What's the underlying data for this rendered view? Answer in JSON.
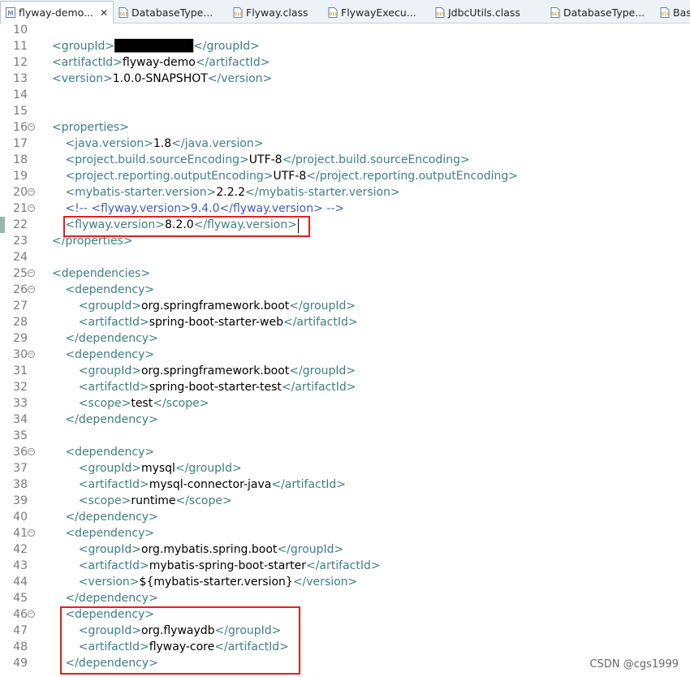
{
  "tabs": [
    {
      "label": "flyway-demo...",
      "icon": "maven-pom-icon",
      "active": true
    },
    {
      "label": "DatabaseType...",
      "icon": "class-file-icon"
    },
    {
      "label": "Flyway.class",
      "icon": "class-file-icon"
    },
    {
      "label": "FlywayExecu...",
      "icon": "class-file-icon"
    },
    {
      "label": "JdbcUtils.class",
      "icon": "class-file-icon"
    },
    {
      "label": "DatabaseType...",
      "icon": "class-file-icon"
    },
    {
      "label": "Base",
      "icon": "class-file-icon"
    }
  ],
  "colors": {
    "tag": "#3f7f7f",
    "text": "#000000",
    "comment": "#3f5fbf",
    "highlight_box": "#e02020"
  },
  "lines": [
    {
      "n": "10",
      "text": ""
    },
    {
      "n": "11",
      "text": "<groupId>█████████</groupId>"
    },
    {
      "n": "12",
      "text": "<artifactId>flyway-demo</artifactId>"
    },
    {
      "n": "13",
      "text": "<version>1.0.0-SNAPSHOT</version>"
    },
    {
      "n": "14",
      "text": ""
    },
    {
      "n": "15",
      "text": ""
    },
    {
      "n": "16",
      "text": "<properties>",
      "fold": true
    },
    {
      "n": "17",
      "text": "  <java.version>1.8</java.version>"
    },
    {
      "n": "18",
      "text": "  <project.build.sourceEncoding>UTF-8</project.build.sourceEncoding>"
    },
    {
      "n": "19",
      "text": "  <project.reporting.outputEncoding>UTF-8</project.reporting.outputEncoding>"
    },
    {
      "n": "20",
      "text": "  <mybatis-starter.version>2.2.2</mybatis-starter.version>",
      "fold": true
    },
    {
      "n": "21",
      "text": "  <!-- <flyway.version>9.4.0</flyway.version> -->",
      "fold": true,
      "comment": true
    },
    {
      "n": "22",
      "text": "  <flyway.version>8.2.0</flyway.version>",
      "marked": true
    },
    {
      "n": "23",
      "text": "</properties>"
    },
    {
      "n": "24",
      "text": ""
    },
    {
      "n": "25",
      "text": "<dependencies>",
      "fold": true
    },
    {
      "n": "26",
      "text": "  <dependency>",
      "fold": true
    },
    {
      "n": "27",
      "text": "    <groupId>org.springframework.boot</groupId>"
    },
    {
      "n": "28",
      "text": "    <artifactId>spring-boot-starter-web</artifactId>"
    },
    {
      "n": "29",
      "text": "  </dependency>"
    },
    {
      "n": "30",
      "text": "  <dependency>",
      "fold": true
    },
    {
      "n": "31",
      "text": "    <groupId>org.springframework.boot</groupId>"
    },
    {
      "n": "32",
      "text": "    <artifactId>spring-boot-starter-test</artifactId>"
    },
    {
      "n": "33",
      "text": "    <scope>test</scope>"
    },
    {
      "n": "34",
      "text": "  </dependency>"
    },
    {
      "n": "35",
      "text": ""
    },
    {
      "n": "36",
      "text": "  <dependency>",
      "fold": true
    },
    {
      "n": "37",
      "text": "    <groupId>mysql</groupId>"
    },
    {
      "n": "38",
      "text": "    <artifactId>mysql-connector-java</artifactId>"
    },
    {
      "n": "39",
      "text": "    <scope>runtime</scope>"
    },
    {
      "n": "40",
      "text": "  </dependency>"
    },
    {
      "n": "41",
      "text": "  <dependency>",
      "fold": true
    },
    {
      "n": "42",
      "text": "    <groupId>org.mybatis.spring.boot</groupId>"
    },
    {
      "n": "43",
      "text": "    <artifactId>mybatis-spring-boot-starter</artifactId>"
    },
    {
      "n": "44",
      "text": "    <version>${mybatis-starter.version}</version>"
    },
    {
      "n": "45",
      "text": "  </dependency>"
    },
    {
      "n": "46",
      "text": "  <dependency>",
      "fold": true
    },
    {
      "n": "47",
      "text": "    <groupId>org.flywaydb</groupId>"
    },
    {
      "n": "48",
      "text": "    <artifactId>flyway-core</artifactId>"
    },
    {
      "n": "49",
      "text": "  </dependency>"
    }
  ],
  "watermark": "CSDN @cgs1999"
}
